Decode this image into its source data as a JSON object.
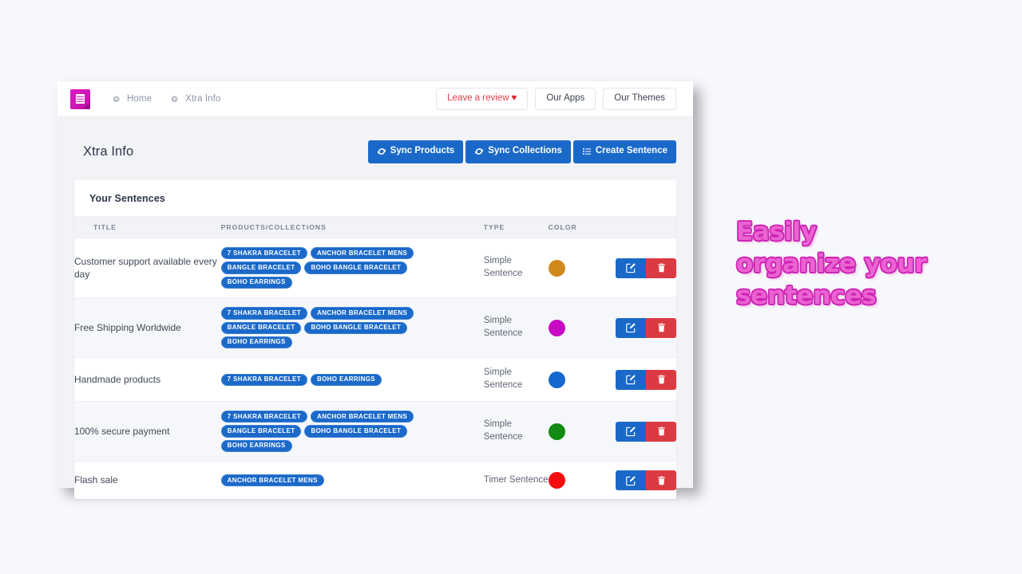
{
  "window": {
    "nav": {
      "logo_icon": "app-list-logo-icon",
      "links": [
        {
          "label": "Home",
          "icon": "gear-icon"
        },
        {
          "label": "Xtra Info",
          "icon": "gear-icon"
        }
      ],
      "buttons": [
        {
          "label": "Leave a review",
          "heart": "♥",
          "name": "leave-a-review-button"
        },
        {
          "label": "Our Apps",
          "name": "our-apps-button"
        },
        {
          "label": "Our Themes",
          "name": "our-themes-button"
        }
      ]
    },
    "page": {
      "title": "Xtra Info",
      "actions": [
        {
          "label": "Sync Products",
          "icon": "sync-icon",
          "name": "sync-products-button"
        },
        {
          "label": "Sync Collections",
          "icon": "sync-icon",
          "name": "sync-collections-button"
        },
        {
          "label": "Create Sentence",
          "icon": "list-icon",
          "name": "create-sentence-button"
        }
      ]
    },
    "card": {
      "title": "Your Sentences",
      "table": {
        "columns": [
          "TITLE",
          "PRODUCTS/COLLECTIONS",
          "TYPE",
          "COLOR",
          ""
        ],
        "rows": [
          {
            "title": "Customer support available every day",
            "tags": [
              "7 SHAKRA BRACELET",
              "ANCHOR BRACELET MENS",
              "BANGLE BRACELET",
              "BOHO BANGLE BRACELET",
              "BOHO EARRINGS"
            ],
            "type": "Simple Sentence",
            "color": "#d08a1c",
            "edit_label": "edit-icon",
            "delete_label": "trash-icon"
          },
          {
            "title": "Free Shipping Worldwide",
            "tags": [
              "7 SHAKRA BRACELET",
              "ANCHOR BRACELET MENS",
              "BANGLE BRACELET",
              "BOHO BANGLE BRACELET",
              "BOHO EARRINGS"
            ],
            "type": "Simple Sentence",
            "color": "#c90ac3",
            "edit_label": "edit-icon",
            "delete_label": "trash-icon"
          },
          {
            "title": "Handmade products",
            "tags": [
              "7 SHAKRA BRACELET",
              "BOHO EARRINGS"
            ],
            "type": "Simple Sentence",
            "color": "#1667cf",
            "edit_label": "edit-icon",
            "delete_label": "trash-icon"
          },
          {
            "title": "100% secure payment",
            "tags": [
              "7 SHAKRA BRACELET",
              "ANCHOR BRACELET MENS",
              "BANGLE BRACELET",
              "BOHO BANGLE BRACELET",
              "BOHO EARRINGS"
            ],
            "type": "Simple Sentence",
            "color": "#128a13",
            "edit_label": "edit-icon",
            "delete_label": "trash-icon"
          },
          {
            "title": "Flash sale",
            "tags": [
              "ANCHOR BRACELET MENS"
            ],
            "type": "Timer Sentence",
            "color": "#f40d0d",
            "edit_label": "edit-icon",
            "delete_label": "trash-icon"
          }
        ]
      }
    }
  },
  "caption": {
    "lines": [
      "Easily",
      "organize your",
      "sentences"
    ],
    "fill_color": "#eb63d2",
    "outline_color": "#cf24b4"
  },
  "colors": {
    "primary": "#1a69c9",
    "danger": "#dc3a43",
    "brand_magenta": "#d515bd",
    "page_background": "#f7f8fc"
  }
}
